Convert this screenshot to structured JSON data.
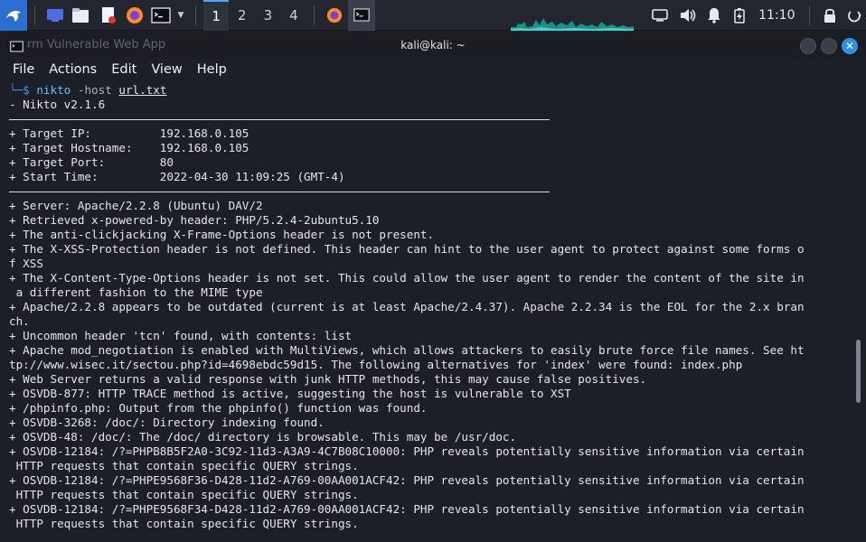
{
  "taskbar": {
    "workspaces": [
      "1",
      "2",
      "3",
      "4"
    ],
    "active_workspace": "1",
    "clock": "11:10",
    "icons": [
      "kali-menu-icon",
      "desktop-icon",
      "file-manager-icon",
      "text-editor-icon",
      "firefox-icon",
      "terminal-icon"
    ],
    "accent": "#4aa8ff"
  },
  "window": {
    "title": "kali@kali: ~",
    "background_hint": "rm Vulnerable Web App",
    "menu": [
      "File",
      "Actions",
      "Edit",
      "View",
      "Help"
    ]
  },
  "terminal": {
    "prompt_symbol": "└─$",
    "command": "nikto",
    "option": "-host",
    "argument": "url.txt",
    "lines": [
      "- Nikto v2.1.6",
      "---RULE---",
      "+ Target IP:          192.168.0.105",
      "+ Target Hostname:    192.168.0.105",
      "+ Target Port:        80",
      "+ Start Time:         2022-04-30 11:09:25 (GMT-4)",
      "---RULE---",
      "+ Server: Apache/2.2.8 (Ubuntu) DAV/2",
      "+ Retrieved x-powered-by header: PHP/5.2.4-2ubuntu5.10",
      "+ The anti-clickjacking X-Frame-Options header is not present.",
      "+ The X-XSS-Protection header is not defined. This header can hint to the user agent to protect against some forms o",
      "f XSS",
      "+ The X-Content-Type-Options header is not set. This could allow the user agent to render the content of the site in",
      " a different fashion to the MIME type",
      "+ Apache/2.2.8 appears to be outdated (current is at least Apache/2.4.37). Apache 2.2.34 is the EOL for the 2.x bran",
      "ch.",
      "+ Uncommon header 'tcn' found, with contents: list",
      "+ Apache mod_negotiation is enabled with MultiViews, which allows attackers to easily brute force file names. See ht",
      "tp://www.wisec.it/sectou.php?id=4698ebdc59d15. The following alternatives for 'index' were found: index.php",
      "+ Web Server returns a valid response with junk HTTP methods, this may cause false positives.",
      "+ OSVDB-877: HTTP TRACE method is active, suggesting the host is vulnerable to XST",
      "+ /phpinfo.php: Output from the phpinfo() function was found.",
      "+ OSVDB-3268: /doc/: Directory indexing found.",
      "+ OSVDB-48: /doc/: The /doc/ directory is browsable. This may be /usr/doc.",
      "+ OSVDB-12184: /?=PHPB8B5F2A0-3C92-11d3-A3A9-4C7B08C10000: PHP reveals potentially sensitive information via certain",
      " HTTP requests that contain specific QUERY strings.",
      "+ OSVDB-12184: /?=PHPE9568F36-D428-11d2-A769-00AA001ACF42: PHP reveals potentially sensitive information via certain",
      " HTTP requests that contain specific QUERY strings.",
      "+ OSVDB-12184: /?=PHPE9568F34-D428-11d2-A769-00AA001ACF42: PHP reveals potentially sensitive information via certain",
      " HTTP requests that contain specific QUERY strings."
    ]
  }
}
